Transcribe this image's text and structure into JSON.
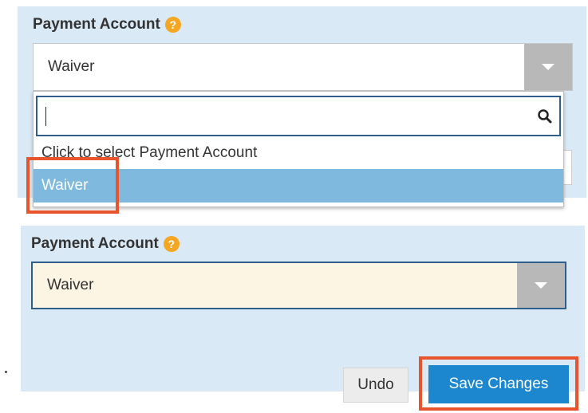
{
  "top_panel": {
    "label": "Payment Account",
    "help_icon": "question-mark-icon",
    "selected_value": "Waiver"
  },
  "dropdown": {
    "search_value": "",
    "options": [
      "Click to select Payment Account",
      "Waiver"
    ],
    "highlighted_option": "Waiver"
  },
  "bottom_panel": {
    "label": "Payment Account",
    "help_icon": "question-mark-icon",
    "selected_value": "Waiver"
  },
  "actions": {
    "undo_label": "Undo",
    "save_label": "Save Changes"
  },
  "colors": {
    "panel_bg": "#d9e9f5",
    "help_icon": "#f5a623",
    "highlight_option": "#7fb9dd",
    "annotation_box": "#e8542c",
    "primary_button": "#1c87cf"
  }
}
